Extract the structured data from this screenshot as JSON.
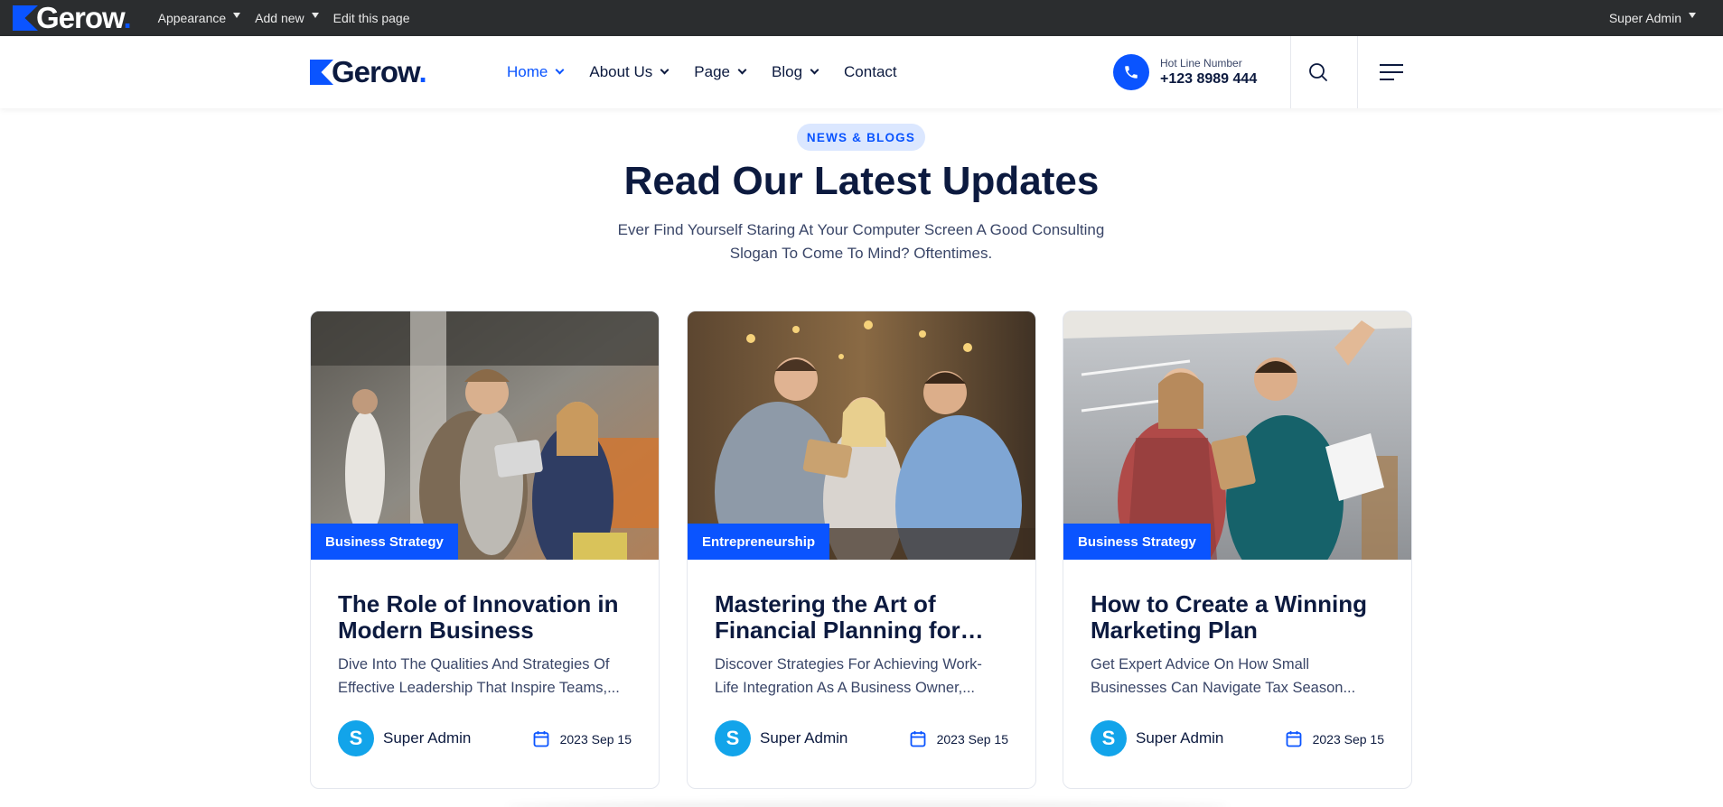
{
  "admin_bar": {
    "logo_text": "Gerow",
    "logo_dot": ".",
    "menu": [
      {
        "label": "Appearance"
      },
      {
        "label": "Add new"
      },
      {
        "label": "Edit this page"
      }
    ],
    "user": "Super Admin"
  },
  "header": {
    "logo_text": "Gerow",
    "logo_dot": ".",
    "nav": [
      {
        "label": "Home",
        "active": true
      },
      {
        "label": "About Us"
      },
      {
        "label": "Page"
      },
      {
        "label": "Blog"
      },
      {
        "label": "Contact"
      }
    ],
    "hotline_label": "Hot Line Number",
    "hotline_number": "+123 8989 444"
  },
  "section": {
    "pill": "NEWS & BLOGS",
    "title": "Read Our Latest Updates",
    "desc_line1": "Ever Find Yourself Staring At Your Computer Screen A Good Consulting",
    "desc_line2": "Slogan To Come To Mind? Oftentimes."
  },
  "posts": [
    {
      "category": "Business Strategy",
      "title_l1": "The Role of Innovation in",
      "title_l2": "Modern Business",
      "excerpt_l1": "Dive Into The Qualities And Strategies Of",
      "excerpt_l2": "Effective Leadership That Inspire Teams,...",
      "avatar_letter": "S",
      "author": "Super Admin",
      "date": "2023 Sep 15"
    },
    {
      "category": "Entrepreneurship",
      "title_l1": "Mastering the Art of",
      "title_l2": "Financial Planning for…",
      "excerpt_l1": "Discover Strategies For Achieving Work-",
      "excerpt_l2": "Life Integration As A Business Owner,...",
      "avatar_letter": "S",
      "author": "Super Admin",
      "date": "2023 Sep 15"
    },
    {
      "category": "Business Strategy",
      "title_l1": "How to Create a Winning",
      "title_l2": "Marketing Plan",
      "excerpt_l1": "Get Expert Advice On How Small",
      "excerpt_l2": "Businesses Can Navigate Tax Season...",
      "avatar_letter": "S",
      "author": "Super Admin",
      "date": "2023 Sep 15"
    }
  ],
  "colors": {
    "brand_blue": "#0a54ff",
    "navy_text": "#0c1a3f",
    "admin_bar_bg": "#2b2d2f",
    "avatar_blue": "#12a4ea",
    "pill_bg": "#dbe7ff"
  },
  "icons": [
    "phone-icon",
    "search-icon",
    "hamburger-menu-icon",
    "calendar-icon",
    "chevron-down-icon",
    "caret-down-icon"
  ]
}
